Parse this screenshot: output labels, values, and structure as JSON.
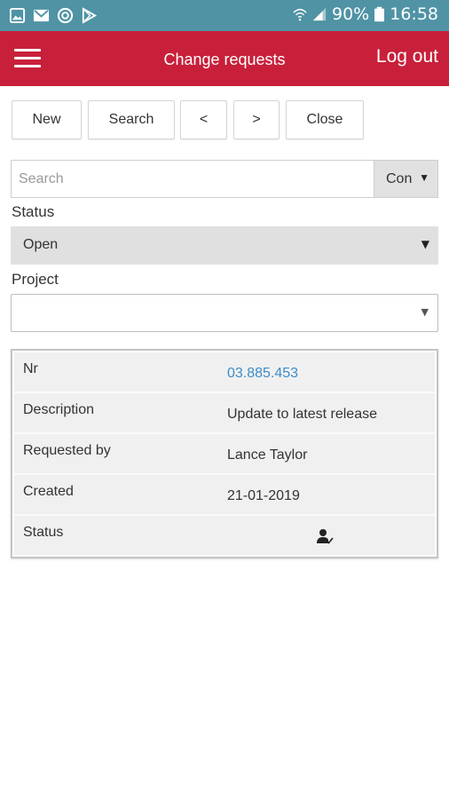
{
  "status_bar": {
    "battery": "90%",
    "time": "16:58",
    "left_icons": [
      "image-icon",
      "mail-icon",
      "sync-icon",
      "play-store-icon"
    ],
    "right_icons": [
      "wifi-icon",
      "signal-icon",
      "battery-icon"
    ]
  },
  "header": {
    "title": "Change requests",
    "logout_label": "Log out",
    "menu_icon": "hamburger-menu-icon",
    "background": "#c8203a"
  },
  "toolbar": {
    "new_label": "New",
    "search_label": "Search",
    "prev_label": "<",
    "next_label": ">",
    "close_label": "Close"
  },
  "search": {
    "placeholder": "Search",
    "value": "",
    "field_select_value": "Con"
  },
  "filters": {
    "status_label": "Status",
    "status_value": "Open",
    "project_label": "Project",
    "project_value": ""
  },
  "details": {
    "rows": [
      {
        "key": "Nr",
        "value": "03.885.453"
      },
      {
        "key": "Description",
        "value": "Update to latest release"
      },
      {
        "key": "Requested by",
        "value": "Lance Taylor"
      },
      {
        "key": "Created",
        "value": "21-01-2019"
      },
      {
        "key": "Status",
        "value_icon": "user-check-icon"
      }
    ],
    "link_color": "#3a8cc9"
  }
}
